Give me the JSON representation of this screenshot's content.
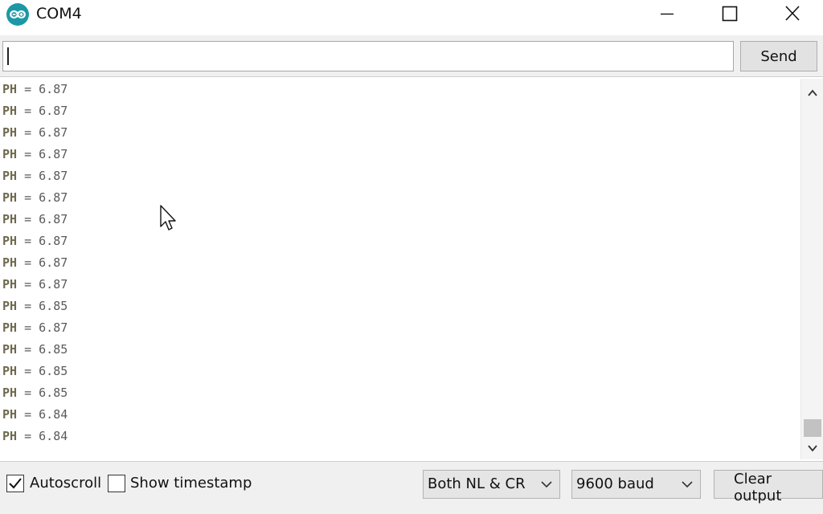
{
  "window": {
    "title": "COM4",
    "icon": "arduino-logo-icon",
    "controls": [
      "minimize-icon",
      "maximize-icon",
      "close-icon"
    ]
  },
  "send": {
    "input_value": "",
    "button_label": "Send"
  },
  "output": {
    "lines": [
      {
        "label": "PH",
        "sep": " = ",
        "value": "6.87"
      },
      {
        "label": "PH",
        "sep": " = ",
        "value": "6.87"
      },
      {
        "label": "PH",
        "sep": " = ",
        "value": "6.87"
      },
      {
        "label": "PH",
        "sep": " = ",
        "value": "6.87"
      },
      {
        "label": "PH",
        "sep": " = ",
        "value": "6.87"
      },
      {
        "label": "PH",
        "sep": " = ",
        "value": "6.87"
      },
      {
        "label": "PH",
        "sep": " = ",
        "value": "6.87"
      },
      {
        "label": "PH",
        "sep": " = ",
        "value": "6.87"
      },
      {
        "label": "PH",
        "sep": " = ",
        "value": "6.87"
      },
      {
        "label": "PH",
        "sep": " = ",
        "value": "6.87"
      },
      {
        "label": "PH",
        "sep": " = ",
        "value": "6.85"
      },
      {
        "label": "PH",
        "sep": " = ",
        "value": "6.87"
      },
      {
        "label": "PH",
        "sep": " = ",
        "value": "6.85"
      },
      {
        "label": "PH",
        "sep": " = ",
        "value": "6.85"
      },
      {
        "label": "PH",
        "sep": " = ",
        "value": "6.85"
      },
      {
        "label": "PH",
        "sep": " = ",
        "value": "6.84"
      },
      {
        "label": "PH",
        "sep": " = ",
        "value": "6.84"
      }
    ]
  },
  "bottom": {
    "autoscroll": {
      "label": "Autoscroll",
      "checked": true
    },
    "timestamp": {
      "label": "Show timestamp",
      "checked": false
    },
    "line_ending": "Both NL & CR",
    "baud": "9600 baud",
    "clear_label": "Clear output"
  },
  "colors": {
    "accent": "#1c98a5",
    "toolbar_bg": "#f0f0f0",
    "text_dim": "#5a5a5a"
  }
}
